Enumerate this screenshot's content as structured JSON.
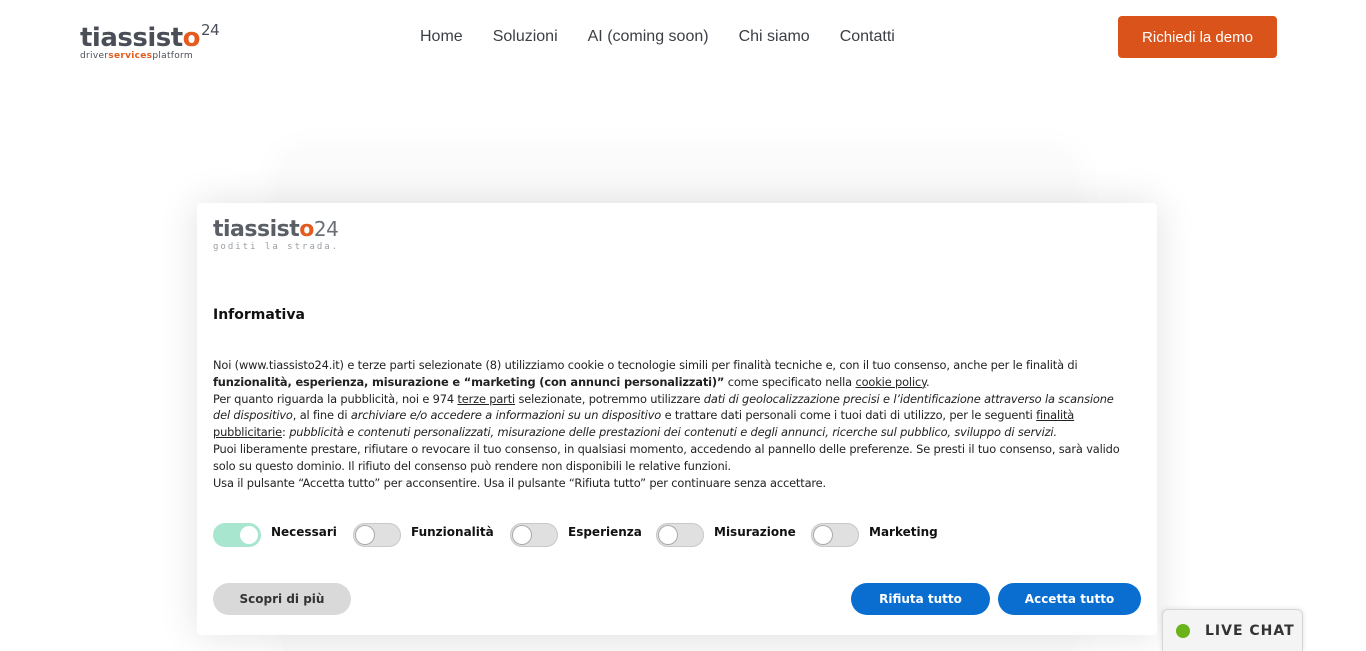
{
  "header": {
    "logo": {
      "wordmark_pre": "tiassist",
      "wordmark_o": "o",
      "wordmark_num": "24",
      "tag_pre": "driver",
      "tag_mid": "services",
      "tag_post": "platform"
    },
    "nav": [
      "Home",
      "Soluzioni",
      "AI (coming soon)",
      "Chi siamo",
      "Contatti"
    ],
    "cta": "Richiedi la demo"
  },
  "dialog": {
    "logo": {
      "wordmark_pre": "tiassist",
      "wordmark_o": "o",
      "wordmark_num": "24",
      "tagline": "goditi la strada."
    },
    "title": "Informativa",
    "p1": {
      "t1": "Noi (www.tiassisto24.it) e terze parti selezionate (8) utilizziamo cookie o tecnologie simili per finalità tecniche e, con il tuo consenso, anche per le finalità di ",
      "b1": "funzionalità, esperienza, misurazione e “marketing (con annunci personalizzati)”",
      "t2": " come specificato nella ",
      "link": "cookie policy",
      "t3": "."
    },
    "p2": {
      "t1": "Per quanto riguarda la pubblicità, noi e 974 ",
      "link1": "terze parti",
      "t2": " selezionate, potremmo utilizzare ",
      "i1": "dati di geolocalizzazione precisi e l’identificazione attraverso la scansione del dispositivo",
      "t3": ", al fine di ",
      "i2": "archiviare e/o accedere a informazioni su un dispositivo",
      "t4": " e trattare dati personali come i tuoi dati di utilizzo, per le seguenti ",
      "link2": "finalità pubblicitarie",
      "t5": ": ",
      "i3": "pubblicità e contenuti personalizzati, misurazione delle prestazioni dei contenuti e degli annunci, ricerche sul pubblico, sviluppo di servizi."
    },
    "p3": "Puoi liberamente prestare, rifiutare o revocare il tuo consenso, in qualsiasi momento, accedendo al pannello delle preferenze. Se presti il tuo consenso, sarà valido solo su questo dominio. Il rifiuto del consenso può rendere non disponibili le relative funzioni.",
    "p4": "Usa il pulsante “Accetta tutto” per acconsentire. Usa il pulsante “Rifiuta tutto” per continuare senza accettare.",
    "toggles": [
      {
        "label": "Necessari",
        "on": true
      },
      {
        "label": "Funzionalità",
        "on": false
      },
      {
        "label": "Esperienza",
        "on": false
      },
      {
        "label": "Misurazione",
        "on": false
      },
      {
        "label": "Marketing",
        "on": false
      }
    ],
    "buttons": {
      "more": "Scopri di più",
      "reject": "Rifiuta tutto",
      "accept": "Accetta tutto"
    }
  },
  "livechat": {
    "label": "LIVE CHAT"
  },
  "colors": {
    "brand_orange": "#d9531b",
    "primary_blue": "#0a6ed1",
    "toggle_on": "#a8e6d0",
    "chat_online": "#6bb31a"
  }
}
